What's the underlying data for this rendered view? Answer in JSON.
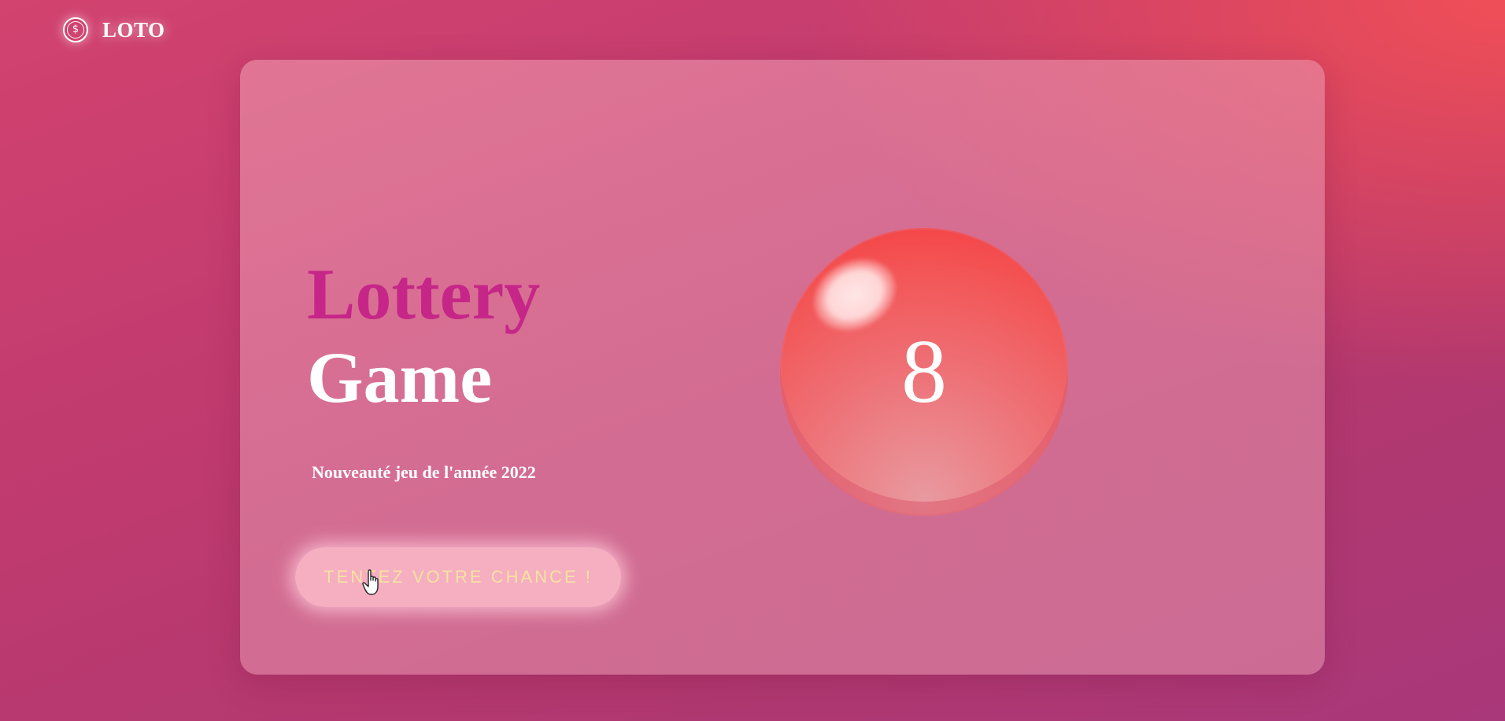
{
  "header": {
    "logo_icon": "dollar-coin-icon",
    "brand": "LOTO"
  },
  "hero": {
    "title_line1": "Lottery",
    "title_line2": "Game",
    "subtitle": "Nouveauté jeu de l'année 2022",
    "cta_label": "TENTEZ VOTRE CHANCE !"
  },
  "ball": {
    "number": "8"
  },
  "colors": {
    "title_accent": "#c62688",
    "ball": "#f35556",
    "cta_text": "#f5e3a0"
  }
}
